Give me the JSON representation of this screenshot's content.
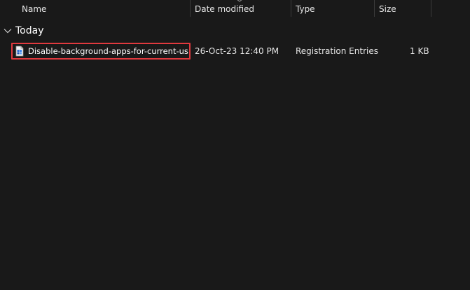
{
  "columns": {
    "name": "Name",
    "date_modified": "Date modified",
    "type": "Type",
    "size": "Size"
  },
  "group": {
    "label": "Today",
    "icon": "chevron-down-icon"
  },
  "files": [
    {
      "name": "Disable-background-apps-for-current-us...",
      "date_modified": "26-Oct-23 12:40 PM",
      "type": "Registration Entries",
      "size": "1 KB",
      "icon": "registry-file-icon",
      "highlighted": true
    }
  ],
  "colors": {
    "background": "#191919",
    "highlight_border": "#e0393e",
    "text": "#ffffff"
  }
}
